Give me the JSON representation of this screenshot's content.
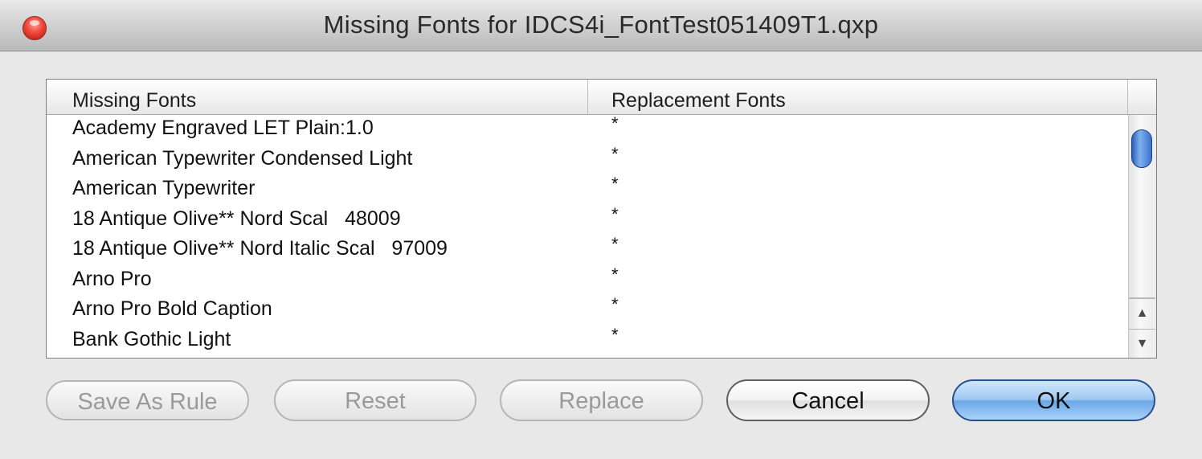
{
  "window": {
    "title": "Missing Fonts for IDCS4i_FontTest051409T1.qxp"
  },
  "table": {
    "columns": [
      "Missing Fonts",
      "Replacement Fonts"
    ],
    "rows": [
      {
        "missing": "Academy Engraved LET Plain:1.0",
        "replacement": "*"
      },
      {
        "missing": "American Typewriter Condensed Light",
        "replacement": "*"
      },
      {
        "missing": "American Typewriter",
        "replacement": "*"
      },
      {
        "missing": "18 Antique Olive** Nord Scal   48009",
        "replacement": "*"
      },
      {
        "missing": "18 Antique Olive** Nord Italic Scal   97009",
        "replacement": "*"
      },
      {
        "missing": "Arno Pro",
        "replacement": "*"
      },
      {
        "missing": "Arno Pro Bold Caption",
        "replacement": "*"
      },
      {
        "missing": "Bank Gothic Light",
        "replacement": "*"
      }
    ]
  },
  "scrollbar": {
    "up_glyph": "▲",
    "down_glyph": "▼"
  },
  "buttons": {
    "save_as_rule": "Save As Rule",
    "reset": "Reset",
    "replace": "Replace",
    "cancel": "Cancel",
    "ok": "OK"
  },
  "icons": {
    "close": "close-icon",
    "scroll_up": "arrow-up-icon",
    "scroll_down": "arrow-down-icon"
  },
  "colors": {
    "close_button": "#e8382c",
    "default_button": "#7ab2ec",
    "scroll_thumb": "#3b73cf"
  }
}
